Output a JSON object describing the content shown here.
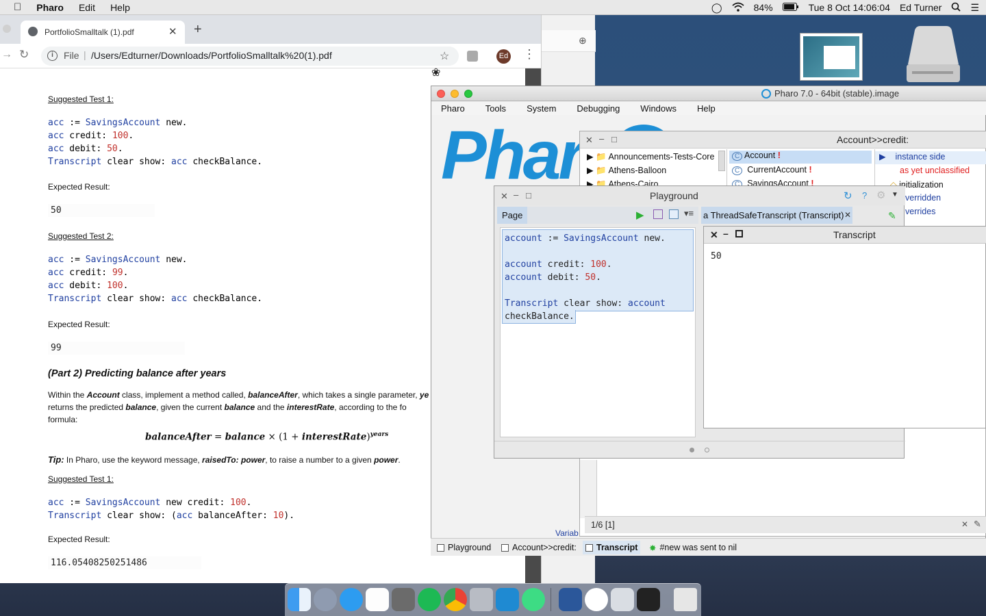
{
  "menubar": {
    "app": "Pharo",
    "items": [
      "Edit",
      "Help"
    ],
    "battery": "84%",
    "clock": "Tue 8 Oct  14:06:04",
    "user": "Ed Turner"
  },
  "chrome": {
    "tab_title": "PortfolioSmalltalk (1).pdf",
    "url_scheme": "File",
    "url": "/Users/Edturner/Downloads/PortfolioSmalltalk%20(1).pdf",
    "avatar": "Ed"
  },
  "pdf": {
    "test1_heading": "Suggested Test 1:",
    "test1_lines": [
      [
        [
          "kw",
          "acc"
        ],
        [
          "t",
          " := "
        ],
        [
          "kw",
          "SavingsAccount"
        ],
        [
          "t",
          " new."
        ]
      ],
      [
        [
          "kw",
          "acc"
        ],
        [
          "t",
          " credit: "
        ],
        [
          "num",
          "100"
        ],
        [
          "t",
          "."
        ]
      ],
      [
        [
          "kw",
          "acc"
        ],
        [
          "t",
          " debit: "
        ],
        [
          "num",
          "50"
        ],
        [
          "t",
          "."
        ]
      ],
      [
        [
          "kw",
          "Transcript"
        ],
        [
          "t",
          " clear show: "
        ],
        [
          "kw",
          "acc"
        ],
        [
          "t",
          " checkBalance."
        ]
      ]
    ],
    "expected1_label": "Expected Result:",
    "expected1_value": "50",
    "test2_heading": "Suggested Test 2:",
    "test2_lines": [
      [
        [
          "kw",
          "acc"
        ],
        [
          "t",
          " := "
        ],
        [
          "kw",
          "SavingsAccount"
        ],
        [
          "t",
          " new."
        ]
      ],
      [
        [
          "kw",
          "acc"
        ],
        [
          "t",
          " credit: "
        ],
        [
          "num",
          "99"
        ],
        [
          "t",
          "."
        ]
      ],
      [
        [
          "kw",
          "acc"
        ],
        [
          "t",
          " debit: "
        ],
        [
          "num",
          "100"
        ],
        [
          "t",
          "."
        ]
      ],
      [
        [
          "kw",
          "Transcript"
        ],
        [
          "t",
          " clear show: "
        ],
        [
          "kw",
          "acc"
        ],
        [
          "t",
          " checkBalance."
        ]
      ]
    ],
    "expected2_label": "Expected Result:",
    "expected2_value": "99",
    "part2_heading": "(Part 2) Predicting balance after years",
    "para1_a": "Within the ",
    "para1_b": "Account",
    "para1_c": " class, implement a method called, ",
    "para1_d": "balanceAfter",
    "para1_e": ", which takes a single parameter, ",
    "para1_f": "ye",
    "para2_a": "returns the predicted ",
    "para2_b": "balance",
    "para2_c": ", given the current ",
    "para2_d": "balance",
    "para2_e": " and the ",
    "para2_f": "interestRate",
    "para2_g": ", according to the fo",
    "para3": "formula:",
    "formula_a": "balanceAfter",
    "formula_b": " = ",
    "formula_c": "balance",
    "formula_d": " × (1 + ",
    "formula_e": "interestRate",
    "formula_f": ")",
    "formula_sup": "years",
    "tip_label": "Tip:",
    "tip_a": " In Pharo, use the keyword message, ",
    "tip_b": "raisedTo: power",
    "tip_c": ", to raise a number to a given ",
    "tip_d": "power",
    "tip_e": ".",
    "test3_heading": "Suggested Test 1:",
    "test3_lines": [
      [
        [
          "kw",
          "acc"
        ],
        [
          "t",
          " := "
        ],
        [
          "kw",
          "SavingsAccount"
        ],
        [
          "t",
          " new credit: "
        ],
        [
          "num",
          "100"
        ],
        [
          "t",
          "."
        ]
      ],
      [
        [
          "kw",
          "Transcript"
        ],
        [
          "t",
          " clear show: ("
        ],
        [
          "kw",
          "acc"
        ],
        [
          "t",
          " balanceAfter: "
        ],
        [
          "num",
          "10"
        ],
        [
          "t",
          ")."
        ]
      ]
    ],
    "expected3_label": "Expected Result:",
    "expected3_value": "116.05408250251486"
  },
  "pharo": {
    "title": "Pharo 7.0 - 64bit (stable).image",
    "menu": [
      "Pharo",
      "Tools",
      "System",
      "Debugging",
      "Windows",
      "Help"
    ],
    "logo_text": "Phar"
  },
  "browser": {
    "title": "Account>>credit:",
    "packages": [
      "Announcements-Tests-Core",
      "Athens-Balloon",
      "Athens-Cairo"
    ],
    "classes": [
      "Account",
      "CurrentAccount",
      "SavingsAccount"
    ],
    "protocols": [
      "instance side",
      "as yet unclassified",
      "initialization",
      "verridden",
      "verrides"
    ],
    "status": "1/6 [1]",
    "variables_label": "Variab"
  },
  "playground": {
    "title": "Playground",
    "page_tab": "Page",
    "transcript_tab": "a ThreadSafeTranscript (Transcript)",
    "code_lines": [
      [
        [
          "kw",
          "account"
        ],
        [
          "t",
          " := "
        ],
        [
          "kw",
          "SavingsAccount"
        ],
        [
          "t",
          " new."
        ]
      ],
      [],
      [
        [
          "kw",
          "account"
        ],
        [
          "t",
          " credit: "
        ],
        [
          "num",
          "100"
        ],
        [
          "t",
          "."
        ]
      ],
      [
        [
          "kw",
          "account"
        ],
        [
          "t",
          " debit: "
        ],
        [
          "num",
          "50"
        ],
        [
          "t",
          "."
        ]
      ],
      [],
      [
        [
          "kw",
          "Transcript"
        ],
        [
          "t",
          " clear show: "
        ],
        [
          "kw",
          "account"
        ]
      ],
      [
        [
          "t",
          "checkBalance."
        ]
      ]
    ]
  },
  "transcript": {
    "title": "Transcript",
    "output": "50"
  },
  "taskbar": {
    "items": [
      "Playground",
      "Account>>credit:",
      "Transcript",
      "#new was sent to nil"
    ]
  },
  "colors": {
    "pharo_blue": "#1d8fd6",
    "keyword": "#1f3fa0",
    "number": "#c0302b",
    "selection": "#dce9f7"
  }
}
